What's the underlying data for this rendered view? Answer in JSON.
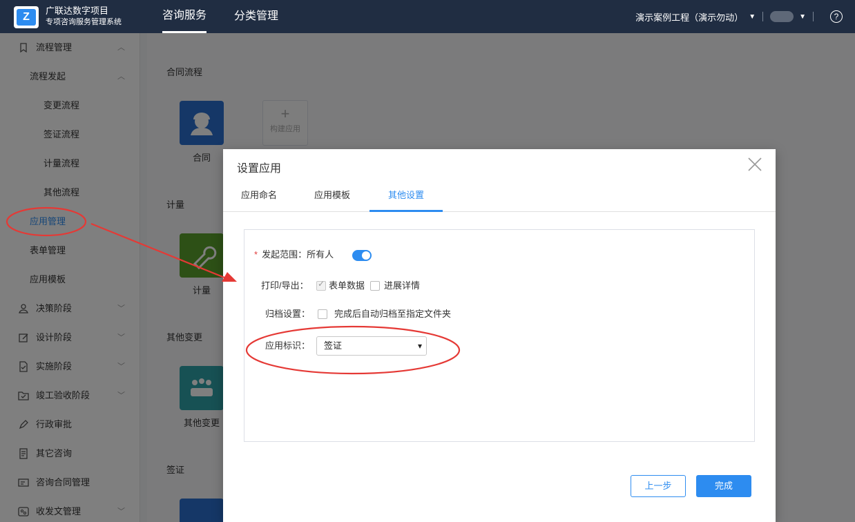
{
  "app": {
    "logo_letter": "Z",
    "brand_line1": "广联达数字项目",
    "brand_line2": "专项咨询服务管理系统"
  },
  "topnav": {
    "items": [
      {
        "label": "咨询服务",
        "active": true
      },
      {
        "label": "分类管理",
        "active": false
      }
    ],
    "project_selector": "演示案例工程（演示勿动）"
  },
  "sidebar": {
    "items": [
      {
        "label": "流程管理",
        "icon": "bookmark-icon",
        "expanded": true
      },
      {
        "label": "流程发起",
        "expanded": true
      },
      {
        "label": "变更流程"
      },
      {
        "label": "签证流程"
      },
      {
        "label": "计量流程"
      },
      {
        "label": "其他流程"
      },
      {
        "label": "应用管理",
        "active": true
      },
      {
        "label": "表单管理"
      },
      {
        "label": "应用模板"
      },
      {
        "label": "决策阶段",
        "icon": "person-icon"
      },
      {
        "label": "设计阶段",
        "icon": "edit-icon"
      },
      {
        "label": "实施阶段",
        "icon": "file-check-icon"
      },
      {
        "label": "竣工验收阶段",
        "icon": "folder-check-icon"
      },
      {
        "label": "行政审批",
        "icon": "pen-icon"
      },
      {
        "label": "其它咨询",
        "icon": "document-icon"
      },
      {
        "label": "咨询合同管理",
        "icon": "card-icon"
      },
      {
        "label": "收发文管理",
        "icon": "mail-settings-icon"
      }
    ]
  },
  "main": {
    "sections": [
      {
        "title": "合同流程",
        "apps": [
          {
            "label": "合同",
            "icon": "worker-icon"
          }
        ],
        "add_label": "构建应用"
      },
      {
        "title": "计量",
        "apps": [
          {
            "label": "计量",
            "icon": "wrench-icon"
          }
        ]
      },
      {
        "title": "其他变更",
        "apps": [
          {
            "label": "其他变更",
            "icon": "meeting-icon"
          }
        ]
      },
      {
        "title": "签证",
        "apps": []
      }
    ]
  },
  "dialog": {
    "title": "设置应用",
    "tabs": [
      {
        "label": "应用命名",
        "active": false
      },
      {
        "label": "应用模板",
        "active": false
      },
      {
        "label": "其他设置",
        "active": true
      }
    ],
    "fields": {
      "scope_label": "发起范围：",
      "scope_value": "所有人",
      "scope_enabled": true,
      "print_label": "打印/导出：",
      "print_options": [
        {
          "label": "表单数据",
          "checked": true
        },
        {
          "label": "进展详情",
          "checked": false
        }
      ],
      "archive_label": "归档设置：",
      "archive_option": {
        "label": "完成后自动归档至指定文件夹",
        "checked": false
      },
      "app_tag_label": "应用标识：",
      "app_tag_value": "签证"
    },
    "buttons": {
      "prev": "上一步",
      "done": "完成"
    }
  },
  "colors": {
    "accent": "#2d8cf0",
    "topbar": "#202d42",
    "annotation": "#e53935"
  }
}
